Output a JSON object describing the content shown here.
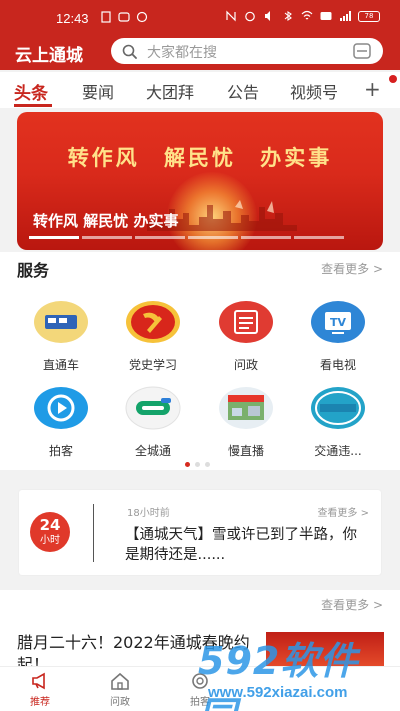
{
  "status_bar": {
    "time": "12:43",
    "battery": "78"
  },
  "header": {
    "title": "云上通城",
    "search_placeholder": "大家都在搜"
  },
  "tabs": [
    {
      "label": "头条"
    },
    {
      "label": "要闻"
    },
    {
      "label": "大团拜"
    },
    {
      "label": "公告"
    },
    {
      "label": "视频号"
    }
  ],
  "tabs_more": "+",
  "banner": {
    "slogan": "转作风 解民忧 办实事",
    "caption": "转作风 解民忧 办实事",
    "slides": 7,
    "active_slide": 1
  },
  "services": {
    "title": "服务",
    "more": "查看更多 >",
    "items": [
      {
        "label": "直通车",
        "icon": "through-train-icon"
      },
      {
        "label": "党史学习",
        "icon": "party-emblem-icon"
      },
      {
        "label": "问政",
        "icon": "inquiry-icon"
      },
      {
        "label": "看电视",
        "icon": "tv-icon"
      },
      {
        "label": "拍客",
        "icon": "video-play-icon"
      },
      {
        "label": "全城通",
        "icon": "city-pass-icon"
      },
      {
        "label": "慢直播",
        "icon": "slow-live-icon"
      },
      {
        "label": "交通违...",
        "icon": "traffic-violation-icon"
      }
    ],
    "pages": 3,
    "active_page": 1
  },
  "news_card": {
    "badge_number": "24",
    "badge_text": "小时",
    "time": "18小时前",
    "more": "查看更多 >",
    "text": "【通城天气】雪或许已到了半路，你是期待还是......"
  },
  "section2": {
    "more": "查看更多 >",
    "article_title": "腊月二十六！2022年通城春晚约起！"
  },
  "bottom_nav": [
    {
      "label": "推荐",
      "icon": "megaphone-icon",
      "active": true
    },
    {
      "label": "问政",
      "icon": "home-icon",
      "active": false
    },
    {
      "label": "拍客",
      "icon": "camera-icon",
      "active": false
    }
  ],
  "watermark": {
    "brand": "592软件园",
    "url": "www.592xiazai.com"
  },
  "colors": {
    "brand_red": "#c8261e",
    "accent_blue": "#2d96e6"
  }
}
